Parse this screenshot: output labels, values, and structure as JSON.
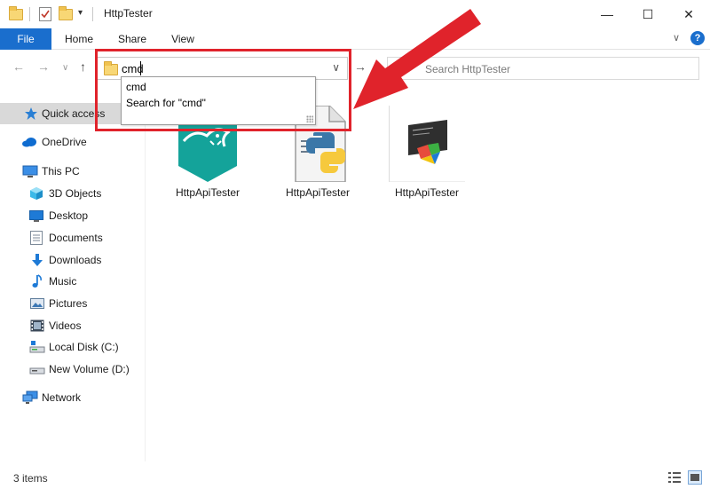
{
  "window": {
    "title": "HttpTester",
    "minimize": "—",
    "maximize": "☐",
    "close": "✕"
  },
  "ribbon": {
    "tabs": [
      "File",
      "Home",
      "Share",
      "View"
    ],
    "expand_glyph": "∨",
    "help_glyph": "?"
  },
  "address_bar": {
    "value": "cmd",
    "search_placeholder": "Search HttpTester"
  },
  "autocomplete": {
    "items": [
      "cmd",
      "Search for \"cmd\""
    ]
  },
  "sidebar": {
    "items": [
      {
        "label": "Quick access",
        "icon": "star-icon"
      },
      {
        "label": "OneDrive",
        "icon": "cloud-icon"
      },
      {
        "label": "This PC",
        "icon": "computer-icon"
      },
      {
        "label": "3D Objects",
        "icon": "cube-icon"
      },
      {
        "label": "Desktop",
        "icon": "desktop-icon"
      },
      {
        "label": "Documents",
        "icon": "document-icon"
      },
      {
        "label": "Downloads",
        "icon": "download-icon"
      },
      {
        "label": "Music",
        "icon": "music-icon"
      },
      {
        "label": "Pictures",
        "icon": "pictures-icon"
      },
      {
        "label": "Videos",
        "icon": "videos-icon"
      },
      {
        "label": "Local Disk (C:)",
        "icon": "drive-icon"
      },
      {
        "label": "New Volume (D:)",
        "icon": "drive-icon"
      },
      {
        "label": "Network",
        "icon": "network-icon"
      }
    ]
  },
  "files": [
    {
      "name": "HttpApiTester",
      "icon": "app-lizard-icon"
    },
    {
      "name": "HttpApiTester",
      "icon": "python-file-icon"
    },
    {
      "name": "HttpApiTester",
      "icon": "console-app-icon"
    }
  ],
  "status": {
    "item_count": "3 items"
  },
  "colors": {
    "accent": "#1a6ecd",
    "highlight": "#e0232b",
    "selected_bg": "#d9d9d9"
  }
}
